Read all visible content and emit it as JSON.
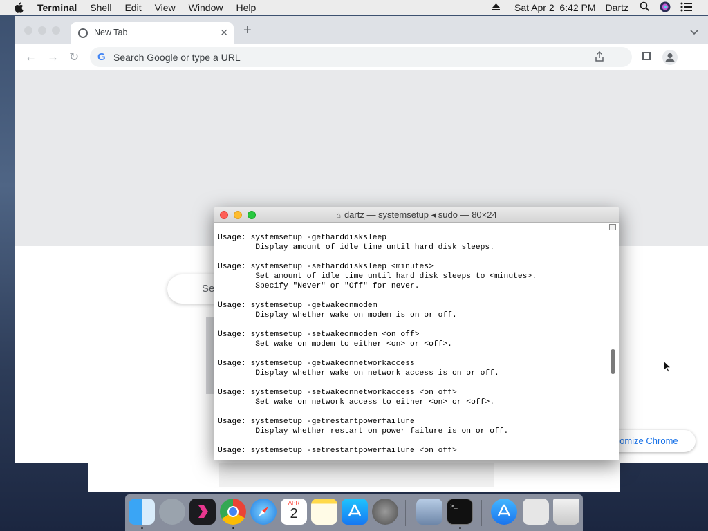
{
  "menubar": {
    "app_name": "Terminal",
    "items": [
      "Shell",
      "Edit",
      "View",
      "Window",
      "Help"
    ],
    "datetime": "Sat Apr 2  6:42 PM",
    "user": "Dartz"
  },
  "browser": {
    "tab_title": "New Tab",
    "omnibox_placeholder": "Search Google or type a URL",
    "search_partial": "Se",
    "customize_label": "Customize Chrome",
    "customize_visible": "stomize Chrome"
  },
  "terminal": {
    "title": "dartz — systemsetup ◂ sudo — 80×24",
    "lines": [
      "Usage: systemsetup -getharddisksleep",
      "        Display amount of idle time until hard disk sleeps.",
      "",
      "Usage: systemsetup -setharddisksleep <minutes>",
      "        Set amount of idle time until hard disk sleeps to <minutes>.",
      "        Specify \"Never\" or \"Off\" for never.",
      "",
      "Usage: systemsetup -getwakeonmodem",
      "        Display whether wake on modem is on or off.",
      "",
      "Usage: systemsetup -setwakeonmodem <on off>",
      "        Set wake on modem to either <on> or <off>.",
      "",
      "Usage: systemsetup -getwakeonnetworkaccess",
      "        Display whether wake on network access is on or off.",
      "",
      "Usage: systemsetup -setwakeonnetworkaccess <on off>",
      "        Set wake on network access to either <on> or <off>.",
      "",
      "Usage: systemsetup -getrestartpowerfailure",
      "        Display whether restart on power failure is on or off.",
      "",
      "Usage: systemsetup -setrestartpowerfailure <on off>"
    ]
  },
  "dock": {
    "calendar_month": "APR",
    "calendar_day": "2",
    "apps": [
      "finder-icon",
      "launchpad-icon",
      "davinci-icon",
      "chrome-icon",
      "safari-icon",
      "calendar-icon",
      "notes-icon",
      "appstore-icon",
      "system-preferences-icon",
      "preview-icon",
      "terminal-icon",
      "downloads-icon",
      "documents-icon",
      "trash-icon"
    ]
  },
  "colors": {
    "close": "#fe5f57",
    "minimize": "#febc2e",
    "zoom": "#28c840",
    "link_blue": "#1a73e8"
  }
}
